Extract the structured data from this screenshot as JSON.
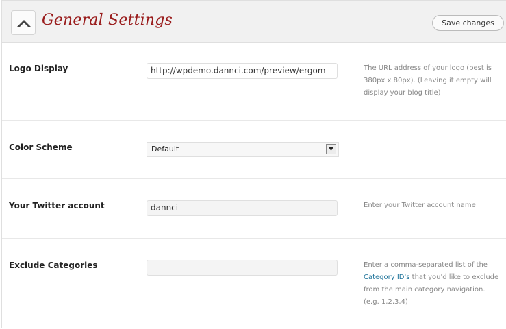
{
  "header": {
    "title": "General Settings",
    "save_label": "Save changes",
    "collapse_icon": "chevron-up-icon"
  },
  "rows": [
    {
      "label": "Logo Display",
      "value": "http://wpdemo.dannci.com/preview/ergom",
      "help": "The URL address of your logo (best is 380px x 80px). (Leaving it empty will display your blog title)"
    },
    {
      "label": "Color Scheme",
      "selected": "Default"
    },
    {
      "label": "Your Twitter account",
      "value": "dannci",
      "help": "Enter your Twitter account name"
    },
    {
      "label": "Exclude Categories",
      "value": "",
      "help_before": "Enter a comma-separated list of the",
      "help_link": "Category ID's",
      "help_after": "that you'd like to exclude from the main category navigation. (e.g. 1,2,3,4)"
    }
  ],
  "colors": {
    "title": "#991b1b",
    "link": "#21759b",
    "help_text": "#888888",
    "header_bg": "#f1f1f1"
  }
}
